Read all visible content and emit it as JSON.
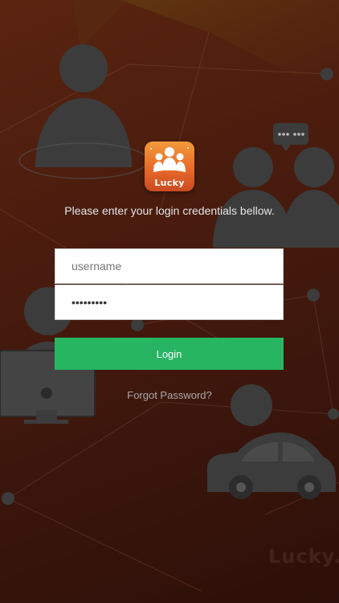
{
  "app": {
    "logo_text": "Lucky",
    "watermark_text": "Lucky."
  },
  "login": {
    "prompt": "Please enter your login credentials bellow.",
    "username_placeholder": "username",
    "username_value": "",
    "password_value": "lucky1234",
    "login_label": "Login",
    "forgot_label": "Forgot Password?"
  },
  "colors": {
    "accent": "#27b562",
    "background": "#4a1c0e",
    "silhouette": "#3c3c3c"
  },
  "icons": [
    "person-silhouette-icon",
    "group-silhouette-icon",
    "chat-bubble-icon",
    "monitor-icon",
    "car-icon"
  ]
}
